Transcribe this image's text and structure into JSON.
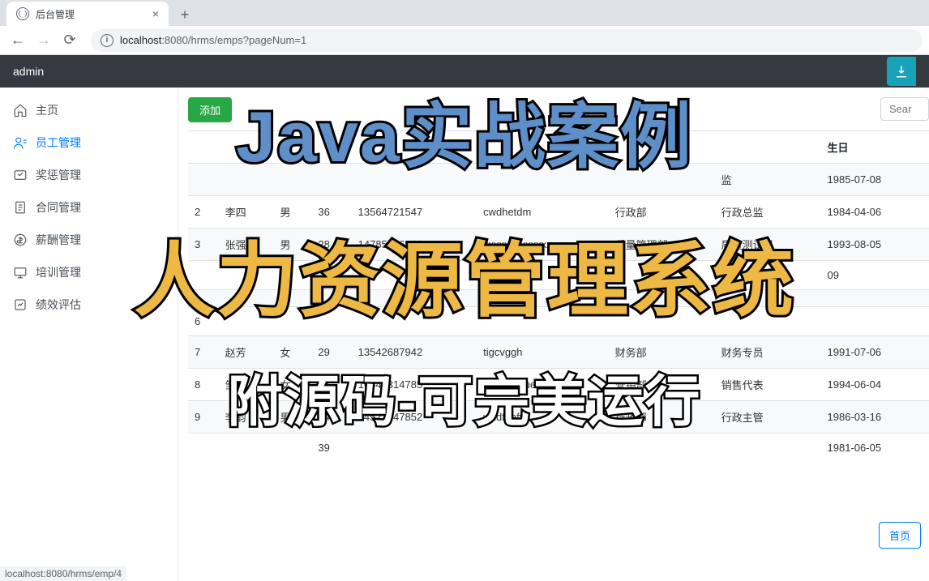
{
  "browser": {
    "tab_title": "后台管理",
    "url_host": "localhost",
    "url_port": ":8080",
    "url_path": "/hrms/emps?pageNum=1",
    "status_url": "localhost:8080/hrms/emp/4"
  },
  "header": {
    "user": "admin"
  },
  "sidebar": {
    "items": [
      {
        "label": "主页"
      },
      {
        "label": "员工管理"
      },
      {
        "label": "奖惩管理"
      },
      {
        "label": "合同管理"
      },
      {
        "label": "薪酬管理"
      },
      {
        "label": "培训管理"
      },
      {
        "label": "绩效评估"
      }
    ]
  },
  "toolbar": {
    "add_label": "添加",
    "search_placeholder": "Sear"
  },
  "table": {
    "headers": {
      "birthday": "生日"
    },
    "rows": [
      {
        "id": "",
        "name": "",
        "gender": "",
        "age": "",
        "phone": "",
        "email": "",
        "dept": "",
        "position": "监",
        "birthday": "1985-07-08"
      },
      {
        "id": "2",
        "name": "李四",
        "gender": "男",
        "age": "36",
        "phone": "13564721547",
        "email": "cwdhetdm",
        "dept": "行政部",
        "position": "行政总监",
        "birthday": "1984-04-06"
      },
      {
        "id": "3",
        "name": "张强",
        "gender": "男",
        "age": "28",
        "phone": "14785426357",
        "email": "xxxxxxxxxxxxx",
        "dept": "质量管理部",
        "position": "质量测试员",
        "birthday": "1993-08-05"
      },
      {
        "id": "",
        "name": "",
        "gender": "",
        "age": "",
        "phone": "",
        "email": "",
        "dept": "",
        "position": "",
        "birthday": "09"
      },
      {
        "id": "",
        "name": "",
        "gender": "",
        "age": "",
        "phone": "",
        "email": "",
        "dept": "",
        "position": "",
        "birthday": ""
      },
      {
        "id": "6",
        "name": "",
        "gender": "",
        "age": "",
        "phone": "",
        "email": "",
        "dept": "",
        "position": "",
        "birthday": ""
      },
      {
        "id": "7",
        "name": "赵芳",
        "gender": "女",
        "age": "29",
        "phone": "13542687942",
        "email": "tigcvggh",
        "dept": "财务部",
        "position": "财务专员",
        "birthday": "1991-07-06"
      },
      {
        "id": "8",
        "name": "邹好",
        "gender": "女",
        "age": "26",
        "phone": "16542314785",
        "email": "ghskcbwhe",
        "dept": "营销部",
        "position": "销售代表",
        "birthday": "1994-06-04"
      },
      {
        "id": "9",
        "name": "李韵",
        "gender": "男",
        "age": "34",
        "phone": "14523147852",
        "email": "wsdfgefv",
        "dept": "行政部",
        "position": "行政主管",
        "birthday": "1986-03-16"
      },
      {
        "id": "",
        "name": "",
        "gender": "",
        "age": "39",
        "phone": "",
        "email": "",
        "dept": "",
        "position": "",
        "birthday": "1981-06-05"
      }
    ]
  },
  "pagination": {
    "first_label": "首页"
  },
  "overlay": {
    "line1": "Java实战案例",
    "line2": "人力资源管理系统",
    "line3": "附源码-可完美运行"
  }
}
